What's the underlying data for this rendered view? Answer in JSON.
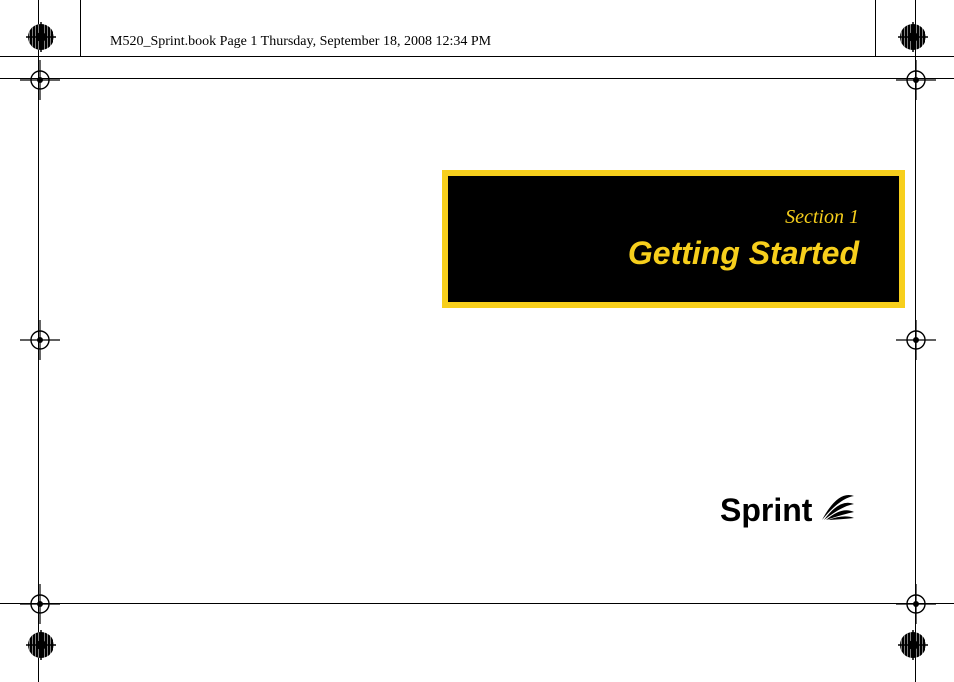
{
  "header": {
    "text": "M520_Sprint.book  Page 1  Thursday, September 18, 2008  12:34 PM"
  },
  "section": {
    "label": "Section 1",
    "title": "Getting Started"
  },
  "logo": {
    "text": "Sprint"
  }
}
